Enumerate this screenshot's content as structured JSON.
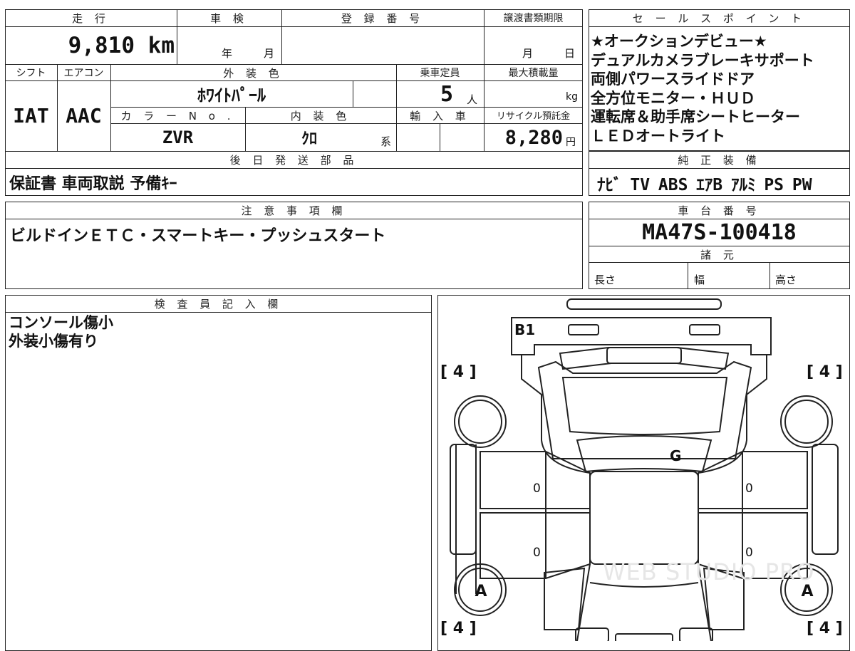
{
  "top": {
    "mileage_header": "走 行",
    "mileage_value": "9,810",
    "mileage_unit": "km",
    "inspection_header": "車 検",
    "inspection_year": "年",
    "inspection_month": "月",
    "registration_header": "登 録 番 号",
    "transfer_header": "譲渡書類期限",
    "transfer_month": "月",
    "transfer_day": "日"
  },
  "row2": {
    "shift_header": "シフト",
    "shift_value": "IAT",
    "ac_header": "エアコン",
    "ac_value": "AAC",
    "exterior_header": "外 装 色",
    "exterior_value": "ﾎﾜｲﾄﾊﾟｰﾙ",
    "capacity_header": "乗車定員",
    "capacity_value": "5",
    "capacity_unit": "人",
    "load_header": "最大積載量",
    "load_unit": "kg",
    "color_no_header": "カ ラ ー N o .",
    "color_no_value": "ZVR",
    "interior_header": "内 装 色",
    "interior_value": "ｸﾛ",
    "interior_suffix": "系",
    "import_header": "輸 入 車",
    "recycle_header": "リサイクル預託金",
    "recycle_value": "8,280",
    "recycle_unit": "円"
  },
  "later_send": {
    "header": "後 日 発 送 部 品",
    "value": "保証書 車両取説 予備ｷｰ"
  },
  "sales": {
    "header": "セ ー ル ス ポ イ ン ト",
    "lines": [
      "★オークションデビュー★",
      "デュアルカメラブレーキサポート",
      "両側パワースライドドア",
      "全方位モニター・ＨＵＤ",
      "運転席＆助手席シートヒーター",
      "ＬＥＤオートライト"
    ]
  },
  "equipment": {
    "header": "純 正 装 備",
    "value": "ﾅﾋﾞ TV ABS ｴｱB ｱﾙﾐ PS PW"
  },
  "notes": {
    "header": "注 意 事 項 欄",
    "value": "ビルドインＥＴＣ・スマートキー・プッシュスタート"
  },
  "chassis": {
    "header": "車 台 番 号",
    "value": "MA47S-100418"
  },
  "specs": {
    "header": "諸 元",
    "length": "長さ",
    "width": "幅",
    "height": "高さ"
  },
  "inspector": {
    "header": "検 査 員 記 入 欄",
    "lines": [
      "コンソール傷小",
      "外装小傷有り"
    ]
  },
  "diagram": {
    "bracket_tl": "[ 4 ]",
    "bracket_tr": "[ 4 ]",
    "bracket_bl": "[ 4 ]",
    "bracket_br": "[ 4 ]",
    "mark_b1": "B1",
    "mark_g": "G",
    "mark_a_left": "A",
    "mark_a_right": "A",
    "door_zero_1": "0",
    "door_zero_2": "0",
    "door_zero_3": "0",
    "door_zero_4": "0",
    "watermark": "WEB STUDIO PRO"
  }
}
